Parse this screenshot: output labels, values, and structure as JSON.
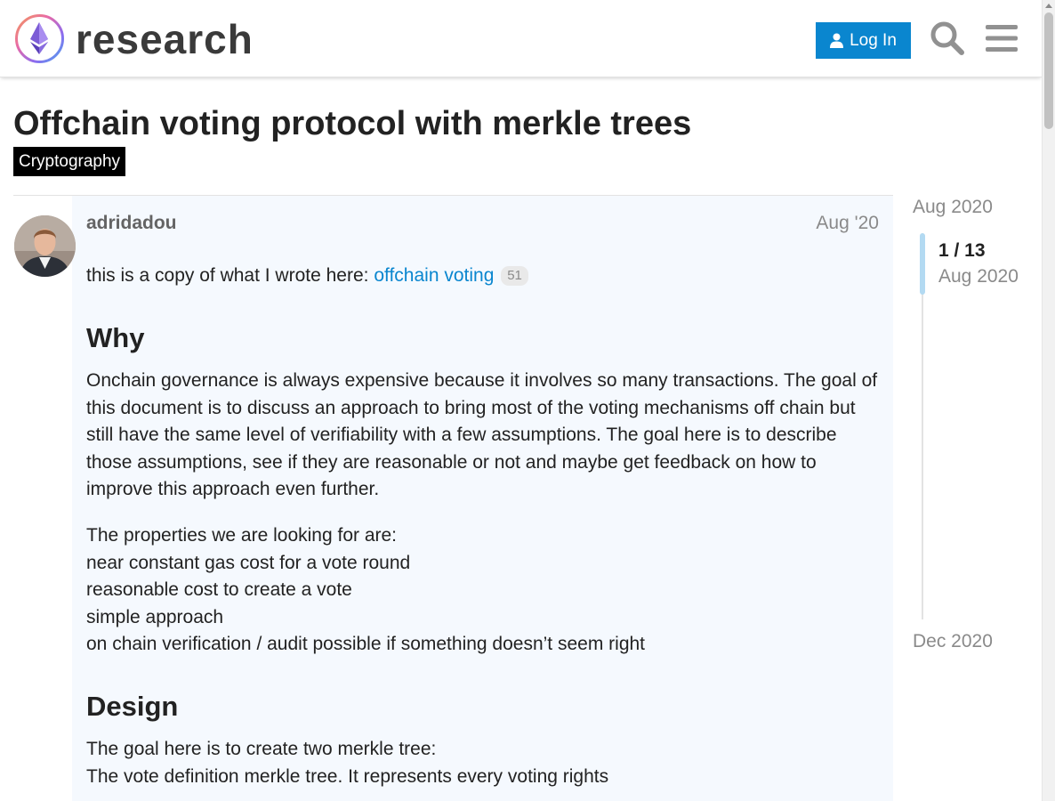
{
  "header": {
    "site_name": "research",
    "login_label": "Log In"
  },
  "topic": {
    "title": "Offchain voting protocol with merkle trees",
    "category": "Cryptography"
  },
  "post": {
    "username": "adridadou",
    "date": "Aug '20",
    "intro_text": "this is a copy of what I wrote here: ",
    "link_text": "offchain voting",
    "link_clicks": "51",
    "heading_why": "Why",
    "why_paragraph": "Onchain governance is always expensive because it involves so many transactions. The goal of this document is to discuss an approach to bring most of the voting mechanisms off chain but still have the same level of verifiability with a few assumptions. The goal here is to describe those assumptions, see if they are reasonable or not and maybe get feedback on how to improve this approach even further.",
    "properties_intro": "The properties we are looking for are:",
    "properties": [
      "near constant gas cost for a vote round",
      "reasonable cost to create a vote",
      "simple approach",
      "on chain verification / audit possible if something doesn’t seem right"
    ],
    "heading_design": "Design",
    "design_line_1": "The goal here is to create two merkle tree:",
    "design_line_2": "The vote definition merkle tree. It represents every voting rights"
  },
  "timeline": {
    "start_date": "Aug 2020",
    "position": "1 / 13",
    "current_date": "Aug 2020",
    "end_date": "Dec 2020"
  },
  "colors": {
    "accent": "#0a86cf",
    "post_background": "#f5f9fe",
    "category_background": "#000000"
  },
  "icons": [
    "ethereum-logo-icon",
    "user-icon",
    "search-icon",
    "hamburger-menu-icon"
  ]
}
